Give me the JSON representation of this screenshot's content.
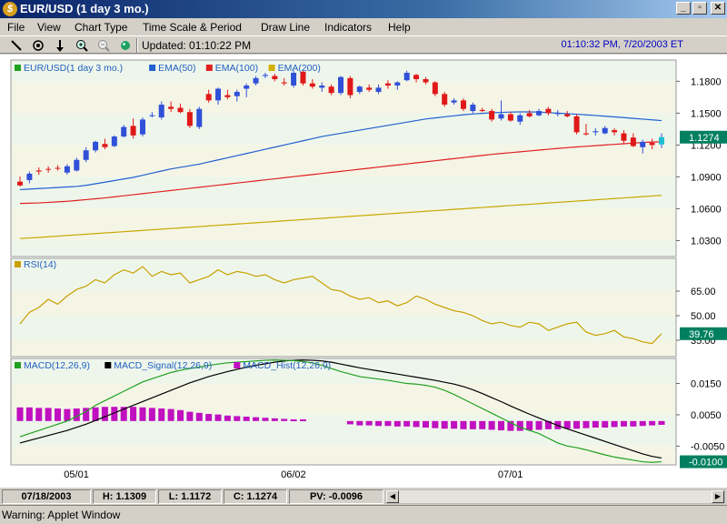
{
  "window": {
    "title": "EUR/USD (1 day  3 mo.)",
    "minimize": "_",
    "restore": "▫",
    "close": "✕"
  },
  "menu": [
    "File",
    "View",
    "Chart Type",
    "Time Scale & Period",
    "Draw Line",
    "Indicators",
    "Help"
  ],
  "toolbar": {
    "icons": [
      "draw-line-icon",
      "crosshair-icon",
      "arrow-down-icon",
      "zoom-in-icon",
      "zoom-out-icon",
      "refresh-icon"
    ],
    "updated_label": "Updated: 01:10:22 PM",
    "datetime": "01:10:32 PM, 7/20/2003 ET"
  },
  "price_panel": {
    "legend": [
      {
        "label": "EUR/USD(1 day  3 mo.)",
        "color": "#20a020"
      },
      {
        "label": "EMA(50)",
        "color": "#2060d0"
      },
      {
        "label": "EMA(100)",
        "color": "#e02020"
      },
      {
        "label": "EMA(200)",
        "color": "#d0b000"
      }
    ],
    "ticks": [
      "1.1800",
      "1.1500",
      "1.1200",
      "1.0900",
      "1.0600",
      "1.0300"
    ],
    "last_value": "1.1274"
  },
  "rsi_panel": {
    "legend": "RSI(14)",
    "ticks": [
      "65.00",
      "50.00",
      "35.00"
    ],
    "last_value": "39.76"
  },
  "macd_panel": {
    "legend": [
      {
        "label": "MACD(12,26,9)",
        "color": "#20a020"
      },
      {
        "label": "MACD_Signal(12,26,9)",
        "color": "#000000"
      },
      {
        "label": "MACD_Hist(12,26,9)",
        "color": "#c010c0"
      }
    ],
    "ticks": [
      "0.0150",
      "0.0050",
      "-0.0050"
    ],
    "last_value": "-0.0100"
  },
  "x_axis": [
    "05/01",
    "06/02",
    "07/01"
  ],
  "status": {
    "date": "07/18/2003",
    "high": "H: 1.1309",
    "low": "L: 1.1172",
    "close": "C: 1.1274",
    "pv": "PV: -0.0096"
  },
  "warning": "Warning: Applet Window",
  "colors": {
    "up": "#3050d8",
    "down": "#e01818",
    "ema50": "#2060d0",
    "ema100": "#e02020",
    "ema200": "#c8a800",
    "rsi": "#c8a000",
    "macd": "#20a020",
    "signal": "#000000",
    "hist": "#c010c0",
    "last_price": "#008060"
  },
  "chart_data": {
    "type": "candlestick",
    "candles": [
      {
        "o": 1.0855,
        "h": 1.0905,
        "l": 1.081,
        "c": 1.082
      },
      {
        "o": 1.087,
        "h": 1.095,
        "l": 1.084,
        "c": 1.093
      },
      {
        "o": 1.096,
        "h": 1.099,
        "l": 1.092,
        "c": 1.095
      },
      {
        "o": 1.0975,
        "h": 1.1,
        "l": 1.094,
        "c": 1.097
      },
      {
        "o": 1.0985,
        "h": 1.101,
        "l": 1.096,
        "c": 1.098
      },
      {
        "o": 1.094,
        "h": 1.102,
        "l": 1.092,
        "c": 1.1
      },
      {
        "o": 1.096,
        "h": 1.108,
        "l": 1.095,
        "c": 1.106
      },
      {
        "o": 1.106,
        "h": 1.118,
        "l": 1.104,
        "c": 1.115
      },
      {
        "o": 1.115,
        "h": 1.124,
        "l": 1.113,
        "c": 1.123
      },
      {
        "o": 1.121,
        "h": 1.126,
        "l": 1.116,
        "c": 1.118
      },
      {
        "o": 1.119,
        "h": 1.129,
        "l": 1.118,
        "c": 1.128
      },
      {
        "o": 1.128,
        "h": 1.139,
        "l": 1.127,
        "c": 1.137
      },
      {
        "o": 1.138,
        "h": 1.145,
        "l": 1.126,
        "c": 1.129
      },
      {
        "o": 1.13,
        "h": 1.146,
        "l": 1.128,
        "c": 1.144
      },
      {
        "o": 1.148,
        "h": 1.151,
        "l": 1.146,
        "c": 1.148
      },
      {
        "o": 1.146,
        "h": 1.161,
        "l": 1.144,
        "c": 1.158
      },
      {
        "o": 1.156,
        "h": 1.161,
        "l": 1.151,
        "c": 1.154
      },
      {
        "o": 1.155,
        "h": 1.159,
        "l": 1.15,
        "c": 1.151
      },
      {
        "o": 1.151,
        "h": 1.154,
        "l": 1.136,
        "c": 1.138
      },
      {
        "o": 1.137,
        "h": 1.156,
        "l": 1.135,
        "c": 1.154
      },
      {
        "o": 1.168,
        "h": 1.172,
        "l": 1.16,
        "c": 1.162
      },
      {
        "o": 1.162,
        "h": 1.174,
        "l": 1.158,
        "c": 1.173
      },
      {
        "o": 1.167,
        "h": 1.172,
        "l": 1.163,
        "c": 1.165
      },
      {
        "o": 1.166,
        "h": 1.172,
        "l": 1.161,
        "c": 1.17
      },
      {
        "o": 1.173,
        "h": 1.178,
        "l": 1.165,
        "c": 1.176
      },
      {
        "o": 1.178,
        "h": 1.185,
        "l": 1.176,
        "c": 1.183
      },
      {
        "o": 1.185,
        "h": 1.188,
        "l": 1.183,
        "c": 1.186
      },
      {
        "o": 1.185,
        "h": 1.187,
        "l": 1.18,
        "c": 1.182
      },
      {
        "o": 1.179,
        "h": 1.183,
        "l": 1.176,
        "c": 1.178
      },
      {
        "o": 1.176,
        "h": 1.19,
        "l": 1.174,
        "c": 1.188
      },
      {
        "o": 1.189,
        "h": 1.19,
        "l": 1.176,
        "c": 1.178
      },
      {
        "o": 1.178,
        "h": 1.182,
        "l": 1.173,
        "c": 1.175
      },
      {
        "o": 1.174,
        "h": 1.179,
        "l": 1.17,
        "c": 1.176
      },
      {
        "o": 1.175,
        "h": 1.177,
        "l": 1.167,
        "c": 1.169
      },
      {
        "o": 1.169,
        "h": 1.185,
        "l": 1.167,
        "c": 1.184
      },
      {
        "o": 1.183,
        "h": 1.185,
        "l": 1.164,
        "c": 1.167
      },
      {
        "o": 1.17,
        "h": 1.176,
        "l": 1.168,
        "c": 1.175
      },
      {
        "o": 1.174,
        "h": 1.177,
        "l": 1.17,
        "c": 1.172
      },
      {
        "o": 1.17,
        "h": 1.177,
        "l": 1.168,
        "c": 1.174
      },
      {
        "o": 1.178,
        "h": 1.181,
        "l": 1.173,
        "c": 1.176
      },
      {
        "o": 1.176,
        "h": 1.18,
        "l": 1.172,
        "c": 1.179
      },
      {
        "o": 1.181,
        "h": 1.19,
        "l": 1.18,
        "c": 1.188
      },
      {
        "o": 1.186,
        "h": 1.187,
        "l": 1.179,
        "c": 1.182
      },
      {
        "o": 1.182,
        "h": 1.184,
        "l": 1.177,
        "c": 1.179
      },
      {
        "o": 1.179,
        "h": 1.18,
        "l": 1.166,
        "c": 1.168
      },
      {
        "o": 1.168,
        "h": 1.17,
        "l": 1.156,
        "c": 1.158
      },
      {
        "o": 1.16,
        "h": 1.164,
        "l": 1.158,
        "c": 1.162
      },
      {
        "o": 1.162,
        "h": 1.164,
        "l": 1.152,
        "c": 1.154
      },
      {
        "o": 1.152,
        "h": 1.16,
        "l": 1.15,
        "c": 1.158
      },
      {
        "o": 1.153,
        "h": 1.155,
        "l": 1.151,
        "c": 1.152
      },
      {
        "o": 1.152,
        "h": 1.154,
        "l": 1.142,
        "c": 1.144
      },
      {
        "o": 1.145,
        "h": 1.162,
        "l": 1.143,
        "c": 1.149
      },
      {
        "o": 1.149,
        "h": 1.151,
        "l": 1.142,
        "c": 1.143
      },
      {
        "o": 1.142,
        "h": 1.15,
        "l": 1.139,
        "c": 1.148
      },
      {
        "o": 1.15,
        "h": 1.153,
        "l": 1.146,
        "c": 1.147
      },
      {
        "o": 1.148,
        "h": 1.154,
        "l": 1.147,
        "c": 1.152
      },
      {
        "o": 1.154,
        "h": 1.156,
        "l": 1.148,
        "c": 1.15
      },
      {
        "o": 1.15,
        "h": 1.153,
        "l": 1.147,
        "c": 1.15
      },
      {
        "o": 1.149,
        "h": 1.152,
        "l": 1.146,
        "c": 1.147
      },
      {
        "o": 1.147,
        "h": 1.149,
        "l": 1.13,
        "c": 1.132
      },
      {
        "o": 1.131,
        "h": 1.14,
        "l": 1.129,
        "c": 1.13
      },
      {
        "o": 1.132,
        "h": 1.136,
        "l": 1.129,
        "c": 1.133
      },
      {
        "o": 1.131,
        "h": 1.138,
        "l": 1.13,
        "c": 1.136
      },
      {
        "o": 1.134,
        "h": 1.136,
        "l": 1.129,
        "c": 1.132
      },
      {
        "o": 1.131,
        "h": 1.134,
        "l": 1.121,
        "c": 1.124
      },
      {
        "o": 1.127,
        "h": 1.131,
        "l": 1.118,
        "c": 1.119
      },
      {
        "o": 1.118,
        "h": 1.125,
        "l": 1.112,
        "c": 1.123
      },
      {
        "o": 1.122,
        "h": 1.126,
        "l": 1.116,
        "c": 1.12
      },
      {
        "o": 1.1205,
        "h": 1.1309,
        "l": 1.1172,
        "c": 1.1274
      }
    ],
    "ema50": [
      1.078,
      1.0785,
      1.079,
      1.0795,
      1.08,
      1.0805,
      1.081,
      1.082,
      1.0835,
      1.085,
      1.0865,
      1.088,
      1.0895,
      1.0915,
      1.0935,
      1.0955,
      1.0975,
      1.099,
      1.1005,
      1.102,
      1.104,
      1.106,
      1.108,
      1.11,
      1.112,
      1.114,
      1.116,
      1.118,
      1.12,
      1.122,
      1.124,
      1.126,
      1.128,
      1.1295,
      1.131,
      1.1325,
      1.134,
      1.1355,
      1.137,
      1.1385,
      1.14,
      1.1415,
      1.143,
      1.1445,
      1.1455,
      1.1465,
      1.1475,
      1.1485,
      1.1492,
      1.1498,
      1.1503,
      1.1507,
      1.151,
      1.1512,
      1.1512,
      1.151,
      1.1505,
      1.15,
      1.1495,
      1.149,
      1.1484,
      1.1478,
      1.1471,
      1.1465,
      1.1458,
      1.1451,
      1.1444,
      1.1437,
      1.143
    ],
    "ema100": [
      1.065,
      1.0652,
      1.0655,
      1.066,
      1.0665,
      1.067,
      1.0678,
      1.0686,
      1.0694,
      1.0702,
      1.0712,
      1.0722,
      1.0732,
      1.0742,
      1.0752,
      1.0762,
      1.0772,
      1.0782,
      1.0792,
      1.0802,
      1.0812,
      1.0822,
      1.0832,
      1.0842,
      1.0852,
      1.0862,
      1.0872,
      1.0882,
      1.0892,
      1.0902,
      1.0912,
      1.0922,
      1.0932,
      1.0942,
      1.0952,
      1.0962,
      1.0972,
      1.0982,
      1.0992,
      1.1002,
      1.1012,
      1.1022,
      1.1032,
      1.1042,
      1.1052,
      1.1062,
      1.1072,
      1.1082,
      1.1092,
      1.1102,
      1.1112,
      1.112,
      1.1128,
      1.1136,
      1.1144,
      1.1152,
      1.116,
      1.1168,
      1.1175,
      1.1182,
      1.1188,
      1.1194,
      1.12,
      1.1206,
      1.1212,
      1.1218,
      1.1224,
      1.1228,
      1.123
    ],
    "ema200": [
      1.032,
      1.0325,
      1.033,
      1.0336,
      1.0342,
      1.0348,
      1.0354,
      1.036,
      1.0366,
      1.0372,
      1.0378,
      1.0384,
      1.039,
      1.0396,
      1.0402,
      1.0408,
      1.0414,
      1.042,
      1.0426,
      1.0432,
      1.0438,
      1.0444,
      1.045,
      1.0456,
      1.0462,
      1.0468,
      1.0474,
      1.048,
      1.0486,
      1.0492,
      1.0498,
      1.0504,
      1.051,
      1.0516,
      1.0522,
      1.0528,
      1.0534,
      1.054,
      1.0546,
      1.0552,
      1.0558,
      1.0564,
      1.057,
      1.0576,
      1.0582,
      1.0588,
      1.0594,
      1.06,
      1.0606,
      1.0612,
      1.0618,
      1.0624,
      1.063,
      1.0636,
      1.0642,
      1.0648,
      1.0654,
      1.066,
      1.0666,
      1.0672,
      1.0678,
      1.0684,
      1.069,
      1.0696,
      1.0702,
      1.0708,
      1.0714,
      1.072,
      1.0726
    ],
    "rsi": [
      45,
      52,
      55,
      60,
      57,
      62,
      66,
      68,
      72,
      70,
      75,
      78,
      76,
      80,
      74,
      77,
      75,
      76,
      70,
      72,
      74,
      78,
      75,
      77,
      76,
      74,
      75,
      72,
      70,
      72,
      73,
      74,
      70,
      66,
      65,
      62,
      60,
      61,
      58,
      59,
      56,
      58,
      62,
      60,
      57,
      55,
      53,
      52,
      50,
      47,
      45,
      46,
      44,
      43,
      46,
      45,
      41,
      43,
      45,
      46,
      40,
      38,
      39,
      41,
      37,
      36,
      34,
      33,
      39
    ],
    "macd": [
      -0.002,
      -0.001,
      0.0,
      0.001,
      0.002,
      0.003,
      0.0045,
      0.006,
      0.008,
      0.0095,
      0.011,
      0.0125,
      0.014,
      0.0155,
      0.0165,
      0.0175,
      0.0185,
      0.0192,
      0.0198,
      0.0202,
      0.0208,
      0.0212,
      0.0216,
      0.0218,
      0.022,
      0.0222,
      0.0224,
      0.0225,
      0.0224,
      0.0223,
      0.022,
      0.0216,
      0.0208,
      0.0198,
      0.0188,
      0.018,
      0.0172,
      0.0168,
      0.0164,
      0.016,
      0.0155,
      0.015,
      0.0148,
      0.0144,
      0.0138,
      0.0128,
      0.0115,
      0.01,
      0.0085,
      0.007,
      0.0055,
      0.004,
      0.0025,
      0.001,
      0.0,
      -0.001,
      -0.0025,
      -0.004,
      -0.005,
      -0.0055,
      -0.0062,
      -0.007,
      -0.0078,
      -0.0085,
      -0.009,
      -0.0095,
      -0.01,
      -0.0102,
      -0.01
    ],
    "signal": [
      -0.004,
      -0.0032,
      -0.0024,
      -0.0016,
      -0.0008,
      0.0,
      0.001,
      0.002,
      0.0032,
      0.0044,
      0.0056,
      0.0068,
      0.008,
      0.0092,
      0.0104,
      0.0116,
      0.0128,
      0.014,
      0.0152,
      0.0162,
      0.0172,
      0.018,
      0.0188,
      0.0195,
      0.0202,
      0.0208,
      0.0213,
      0.0218,
      0.0222,
      0.0224,
      0.0225,
      0.0224,
      0.0222,
      0.0218,
      0.0212,
      0.0206,
      0.02,
      0.0195,
      0.019,
      0.0185,
      0.018,
      0.0175,
      0.017,
      0.0165,
      0.016,
      0.0154,
      0.0148,
      0.014,
      0.013,
      0.0118,
      0.0105,
      0.0092,
      0.0078,
      0.0065,
      0.0052,
      0.004,
      0.0028,
      0.0016,
      0.0005,
      -0.0005,
      -0.0015,
      -0.0025,
      -0.0035,
      -0.0045,
      -0.0055,
      -0.0065,
      -0.0075,
      -0.0083,
      -0.0088
    ],
    "hist": [
      0.0025,
      0.0025,
      0.0024,
      0.0024,
      0.0023,
      0.0022,
      0.0023,
      0.0024,
      0.0025,
      0.0026,
      0.0026,
      0.0026,
      0.0026,
      0.0025,
      0.0024,
      0.0023,
      0.0022,
      0.002,
      0.0017,
      0.0015,
      0.0013,
      0.0012,
      0.001,
      0.0009,
      0.0008,
      0.0007,
      0.0006,
      0.0005,
      0.0004,
      0.0003,
      0.0003,
      null,
      null,
      null,
      null,
      -0.0006,
      -0.0008,
      -0.0008,
      -0.0009,
      -0.0009,
      -0.001,
      -0.001,
      -0.0011,
      -0.0012,
      -0.0013,
      -0.0014,
      -0.0014,
      -0.0015,
      -0.0015,
      -0.0015,
      -0.0016,
      -0.0017,
      -0.0018,
      -0.0018,
      -0.0017,
      -0.0016,
      -0.0015,
      -0.0015,
      -0.0014,
      -0.0014,
      -0.0013,
      -0.0012,
      -0.0012,
      -0.0011,
      -0.001,
      -0.001,
      -0.0009,
      -0.0008,
      -0.0007
    ],
    "price_range": [
      1.015,
      1.2
    ],
    "rsi_range": [
      25,
      85
    ],
    "macd_range": [
      -0.011,
      0.023
    ],
    "x_labels": [
      "05/01",
      "06/02",
      "07/01"
    ]
  }
}
